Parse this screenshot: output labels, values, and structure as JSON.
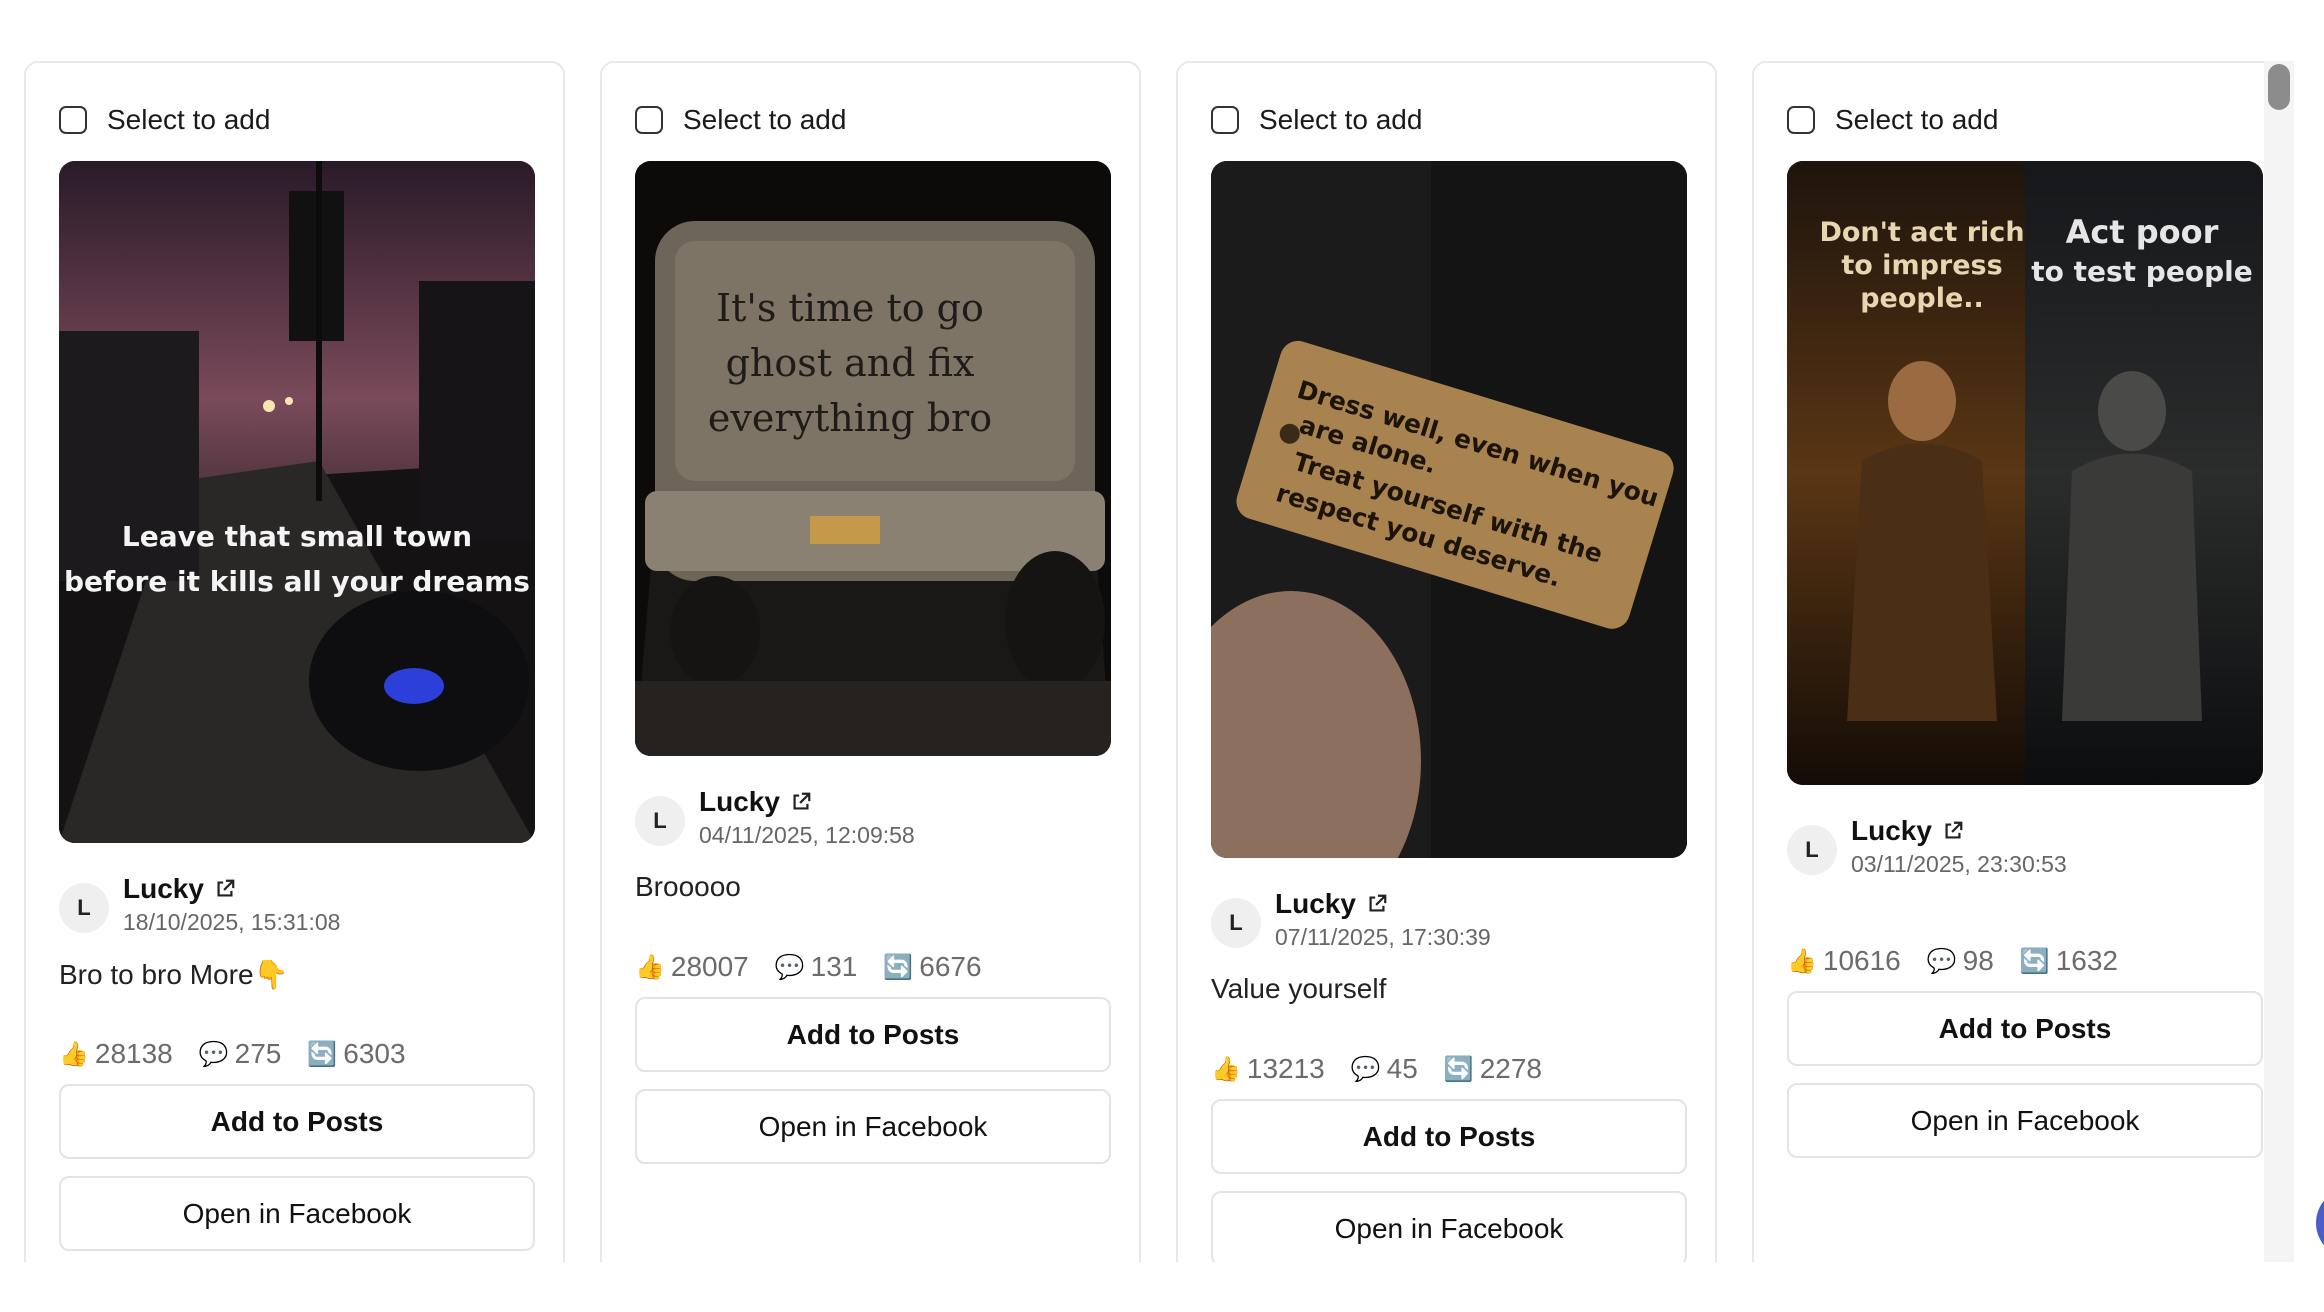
{
  "cards": [
    {
      "select_label": "Select to add",
      "media": {
        "overlay_lines": [
          "Leave that small town",
          "before it kills all your dreams"
        ]
      },
      "author": {
        "initial": "L",
        "name": "Lucky",
        "timestamp": "18/10/2025, 15:31:08"
      },
      "caption": "Bro to bro More👇",
      "stats": {
        "likes": "28138",
        "comments": "275",
        "shares": "6303"
      },
      "add_button": "Add to Posts",
      "open_button": "Open in Facebook"
    },
    {
      "select_label": "Select to add",
      "media": {
        "overlay_lines": [
          "It's time to go",
          "ghost and fix",
          "everything bro"
        ]
      },
      "author": {
        "initial": "L",
        "name": "Lucky",
        "timestamp": "04/11/2025, 12:09:58"
      },
      "caption": "Brooooo",
      "stats": {
        "likes": "28007",
        "comments": "131",
        "shares": "6676"
      },
      "add_button": "Add to Posts",
      "open_button": "Open in Facebook"
    },
    {
      "select_label": "Select to add",
      "media": {
        "overlay_lines": [
          "Dress well, even when you",
          "are alone.",
          "Treat yourself with the",
          "respect you deserve."
        ]
      },
      "author": {
        "initial": "L",
        "name": "Lucky",
        "timestamp": "07/11/2025, 17:30:39"
      },
      "caption": "Value yourself",
      "stats": {
        "likes": "13213",
        "comments": "45",
        "shares": "2278"
      },
      "add_button": "Add to Posts",
      "open_button": "Open in Facebook"
    },
    {
      "select_label": "Select to add",
      "media": {
        "overlay_lines": [
          "Don't act rich",
          "to impress",
          "people..",
          "Act poor",
          "to test people"
        ]
      },
      "author": {
        "initial": "L",
        "name": "Lucky",
        "timestamp": "03/11/2025, 23:30:53"
      },
      "caption": "",
      "stats": {
        "likes": "10616",
        "comments": "98",
        "shares": "1632"
      },
      "add_button": "Add to Posts",
      "open_button": "Open in Facebook"
    }
  ],
  "icons": {
    "like": "thumbs-up-icon",
    "comment": "speech-bubble-icon",
    "share": "repeat-arrows-icon",
    "external": "external-link-icon"
  }
}
